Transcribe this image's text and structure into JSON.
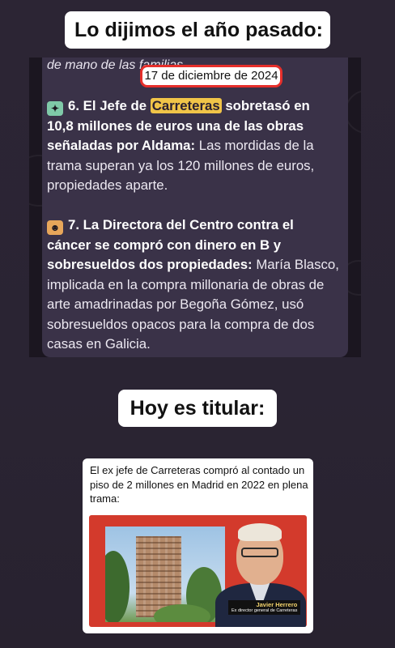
{
  "captions": {
    "top": "Lo dijimos el año pasado:",
    "middle": "Hoy es titular:"
  },
  "chat": {
    "cut_line": "de mano de las familias",
    "date_label": "17 de diciembre de 2024",
    "item6": {
      "emoji": "pin-icon",
      "number": "6.",
      "bold_prefix": "El Jefe de",
      "highlight": "Carreteras",
      "bold_suffix": "sobretasó en 10,8 millones de euros una de las obras señaladas por Aldama:",
      "text": "Las mordidas de la trama superan ya los 120 millones de euros, propiedades aparte."
    },
    "item7": {
      "emoji": "theater-masks-icon",
      "number": "7.",
      "bold": "La Directora del Centro contra el cáncer se compró con dinero en B y sobresueldos dos propiedades:",
      "text": "María Blasco, implicada en la compra millonaria de obras de arte amadrinadas por Begoña Gómez, usó sobresueldos opacos para la compra de dos casas en Galicia."
    }
  },
  "news": {
    "headline": "El ex jefe de Carreteras compró al contado un piso de 2 millones en Madrid en 2022 en plena trama:",
    "name": "Javier Herrero",
    "role": "Ex director general de Carreteras"
  },
  "colors": {
    "background": "#2a2433",
    "bubble": "#3a3248",
    "highlight": "#f0c448",
    "annotation_red": "#e62f2b",
    "image_red": "#d33a2c"
  }
}
